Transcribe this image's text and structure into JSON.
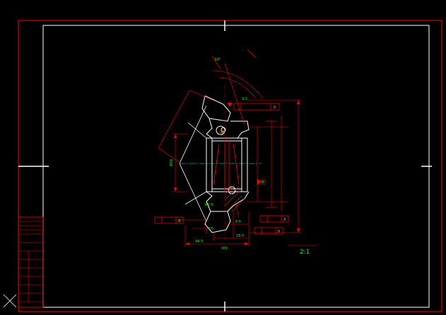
{
  "drawing": {
    "section_label": "",
    "scale_label": "2:1",
    "dims": {
      "d_top_angle": "33°",
      "d_ang2": "",
      "d_ang3": "",
      "d_ang4": "",
      "d_left_slant": "",
      "d_left_dia": "Φ56",
      "d_h1": "",
      "d_h2": "",
      "d_bore": "",
      "d_bot1": "44.5",
      "d_bot2": "M3",
      "d_bot3": "18.5",
      "d_bot4": "8.5",
      "d_bot5": "4.5",
      "d_right1": "",
      "d_right2": "",
      "d_right3": "",
      "d_holes": "",
      "d_ra1": "3.2",
      "d_ra2": "R1.5",
      "d_chamfer": "",
      "d_tol1": "",
      "d_tol2": "",
      "d_tol3": "",
      "d_tol4": ""
    },
    "fcf": {
      "f1_sym": "",
      "f1_val": "",
      "f1_ref": "B",
      "f2_sym": "",
      "f2_val": "",
      "f2_ref": "A",
      "f3_sym": "",
      "f3_val": "",
      "f3_ref": "B",
      "f4_sym": "",
      "f4_val": "",
      "f4_ref": "B"
    },
    "datum_a": "A",
    "datum_b": "B"
  },
  "title_block": {
    "rows": [
      "",
      "",
      "",
      "",
      "",
      ""
    ]
  }
}
